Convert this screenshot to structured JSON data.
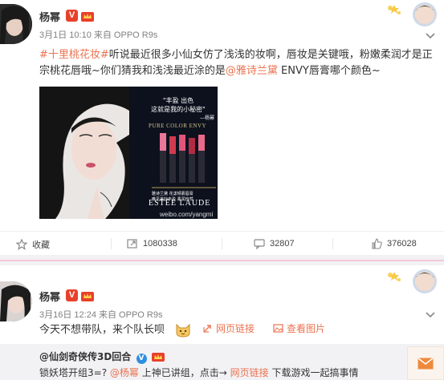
{
  "post1": {
    "username": "杨幂",
    "verified_badge": "V",
    "meta": "3月1日 10:10 来自 OPPO R9s",
    "text_hashtag": "#十里桃花妆#",
    "text_part1": "听说最近很多小仙女仿了浅浅的妆啊，唇妆是关键哦，粉嫩柔润才是正宗桃花唇哦~你们猜我和浅浅最近涂的是",
    "text_mention": "@雅诗兰黛",
    "text_part2": " ENVY唇膏哪个颜色~",
    "image": {
      "tagline_line1": "\"丰盈 出色",
      "tagline_line2": "这就是我的小秘密\"",
      "tagline_sign": "—杨幂",
      "product_line": "PURE COLOR ENVY",
      "product_desc1": "雅诗兰黛 花漾倾慕唇膏",
      "product_desc2": "唯见美妙丰盈 柔润自然",
      "brand": "ESTĒE LAUDE",
      "watermark": "weibo.com/yangmi"
    },
    "actions": {
      "favorite": "收藏",
      "repost": "1080338",
      "comment": "32807",
      "like": "376028"
    }
  },
  "post2": {
    "username": "杨幂",
    "verified_badge": "V",
    "meta": "3月16日 12:24 来自 OPPO R9s",
    "text": "今天不想带队，来个队长呗",
    "link_web": "网页链接",
    "link_image": "查看图片",
    "repost": {
      "author": "@仙剑奇侠传3D回合",
      "author_badge": "V",
      "text": "锁妖塔开组3=?",
      "mention": "@杨幂",
      "text_mid": " 上神已讲组，点击→",
      "link": "网页链接",
      "text_end": " 下载游戏一起搞事情"
    }
  },
  "colors": {
    "accent": "#eb7350",
    "badge": "#e8402b",
    "divider_pink": "#f5c7d7"
  },
  "icons": [
    "chevron-down-icon",
    "star-icon",
    "repost-icon",
    "comment-icon",
    "like-icon",
    "link-icon",
    "image-icon",
    "mail-icon",
    "crown-icon",
    "cat-emoji-icon"
  ]
}
